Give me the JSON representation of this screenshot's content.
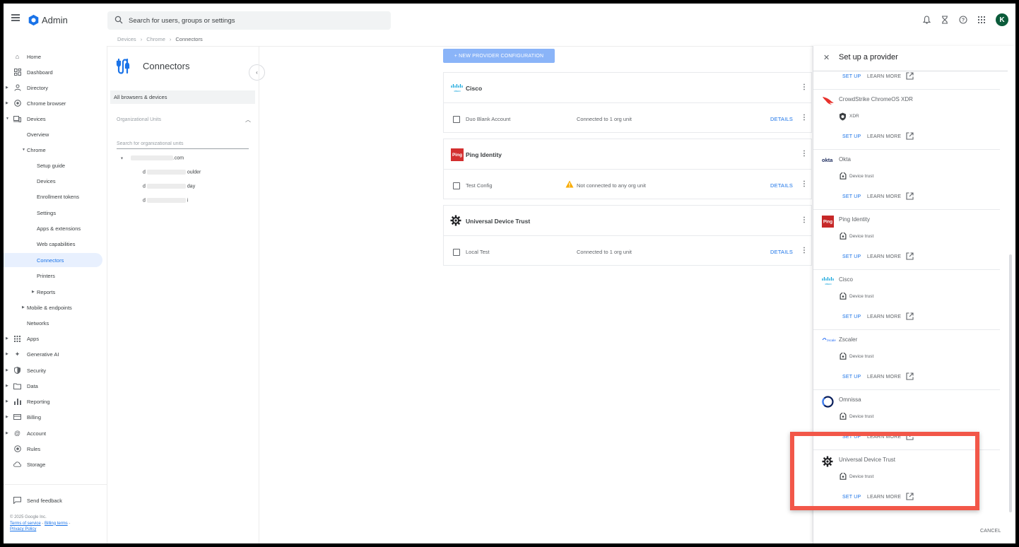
{
  "app": {
    "title": "Admin"
  },
  "search": {
    "placeholder": "Search for users, groups or settings"
  },
  "topbar": {
    "avatar_letter": "K"
  },
  "breadcrumb": [
    "Devices",
    "Chrome",
    "Connectors"
  ],
  "nav": {
    "home": "Home",
    "dashboard": "Dashboard",
    "directory": "Directory",
    "chrome_browser": "Chrome browser",
    "devices": "Devices",
    "overview": "Overview",
    "chrome": "Chrome",
    "setup_guide": "Setup guide",
    "devices_sub": "Devices",
    "enrollment_tokens": "Enrollment tokens",
    "settings": "Settings",
    "apps_extensions": "Apps & extensions",
    "web_capabilities": "Web capabilities",
    "connectors": "Connectors",
    "printers": "Printers",
    "reports": "Reports",
    "mobile_endpoints": "Mobile & endpoints",
    "networks": "Networks",
    "apps": "Apps",
    "generative_ai": "Generative AI",
    "security": "Security",
    "data": "Data",
    "reporting": "Reporting",
    "billing": "Billing",
    "account": "Account",
    "rules": "Rules",
    "storage": "Storage",
    "send_feedback": "Send feedback"
  },
  "footer": {
    "copyright": "© 2025 Google Inc.",
    "terms": "Terms of service",
    "sep1": " - ",
    "billing_terms": "Billing terms",
    "sep2": " -",
    "privacy": "Privacy Policy"
  },
  "ou_panel": {
    "title": "Connectors",
    "all_browsers": "All browsers & devices",
    "ou_header": "Organizational Units",
    "search_placeholder": "Search for organizational units",
    "root_suffix": ".com",
    "children": [
      {
        "prefix": "d",
        "suffix": "oulder"
      },
      {
        "prefix": "d",
        "suffix": "day"
      },
      {
        "prefix": "d",
        "suffix": "i"
      }
    ]
  },
  "main": {
    "new_button": "+ NEW PROVIDER CONFIGURATION",
    "cards": [
      {
        "provider": "Cisco",
        "config": "Duo Blank Account",
        "status": "Connected to 1 org unit",
        "details": "DETAILS",
        "warning": false
      },
      {
        "provider": "Ping Identity",
        "config": "Test Config",
        "status": "Not connected to any org unit",
        "details": "DETAILS",
        "warning": true
      },
      {
        "provider": "Universal Device Trust",
        "config": "Local Test",
        "status": "Connected to 1 org unit",
        "details": "DETAILS",
        "warning": false
      }
    ]
  },
  "drawer": {
    "title": "Set up a provider",
    "cancel": "CANCEL",
    "setup_label": "SET UP",
    "learn_label": "LEARN MORE",
    "providers": [
      {
        "name": "",
        "type": "",
        "logo": "none"
      },
      {
        "name": "CrowdStrike ChromeOS XDR",
        "type": "XDR",
        "logo": "crowdstrike-logo"
      },
      {
        "name": "Okta",
        "type": "Device trust",
        "logo": "okta-logo"
      },
      {
        "name": "Ping Identity",
        "type": "Device trust",
        "logo": "ping-logo"
      },
      {
        "name": "Cisco",
        "type": "Device trust",
        "logo": "cisco-logo"
      },
      {
        "name": "Zscaler",
        "type": "Device trust",
        "logo": "zscaler-logo"
      },
      {
        "name": "Omnissa",
        "type": "Device trust",
        "logo": "omnissa-logo"
      },
      {
        "name": "Universal Device Trust",
        "type": "Device trust",
        "logo": "gear-logo"
      }
    ],
    "logo_texts": {
      "okta": "okta",
      "ping": "Ping",
      "cisco": "cisco",
      "zscaler": "zscaler"
    }
  },
  "colors": {
    "accent": "#1a73e8",
    "highlight": "#f25749",
    "active_nav_bg": "#e8f0fe",
    "avatar": "#0b5b3a"
  }
}
